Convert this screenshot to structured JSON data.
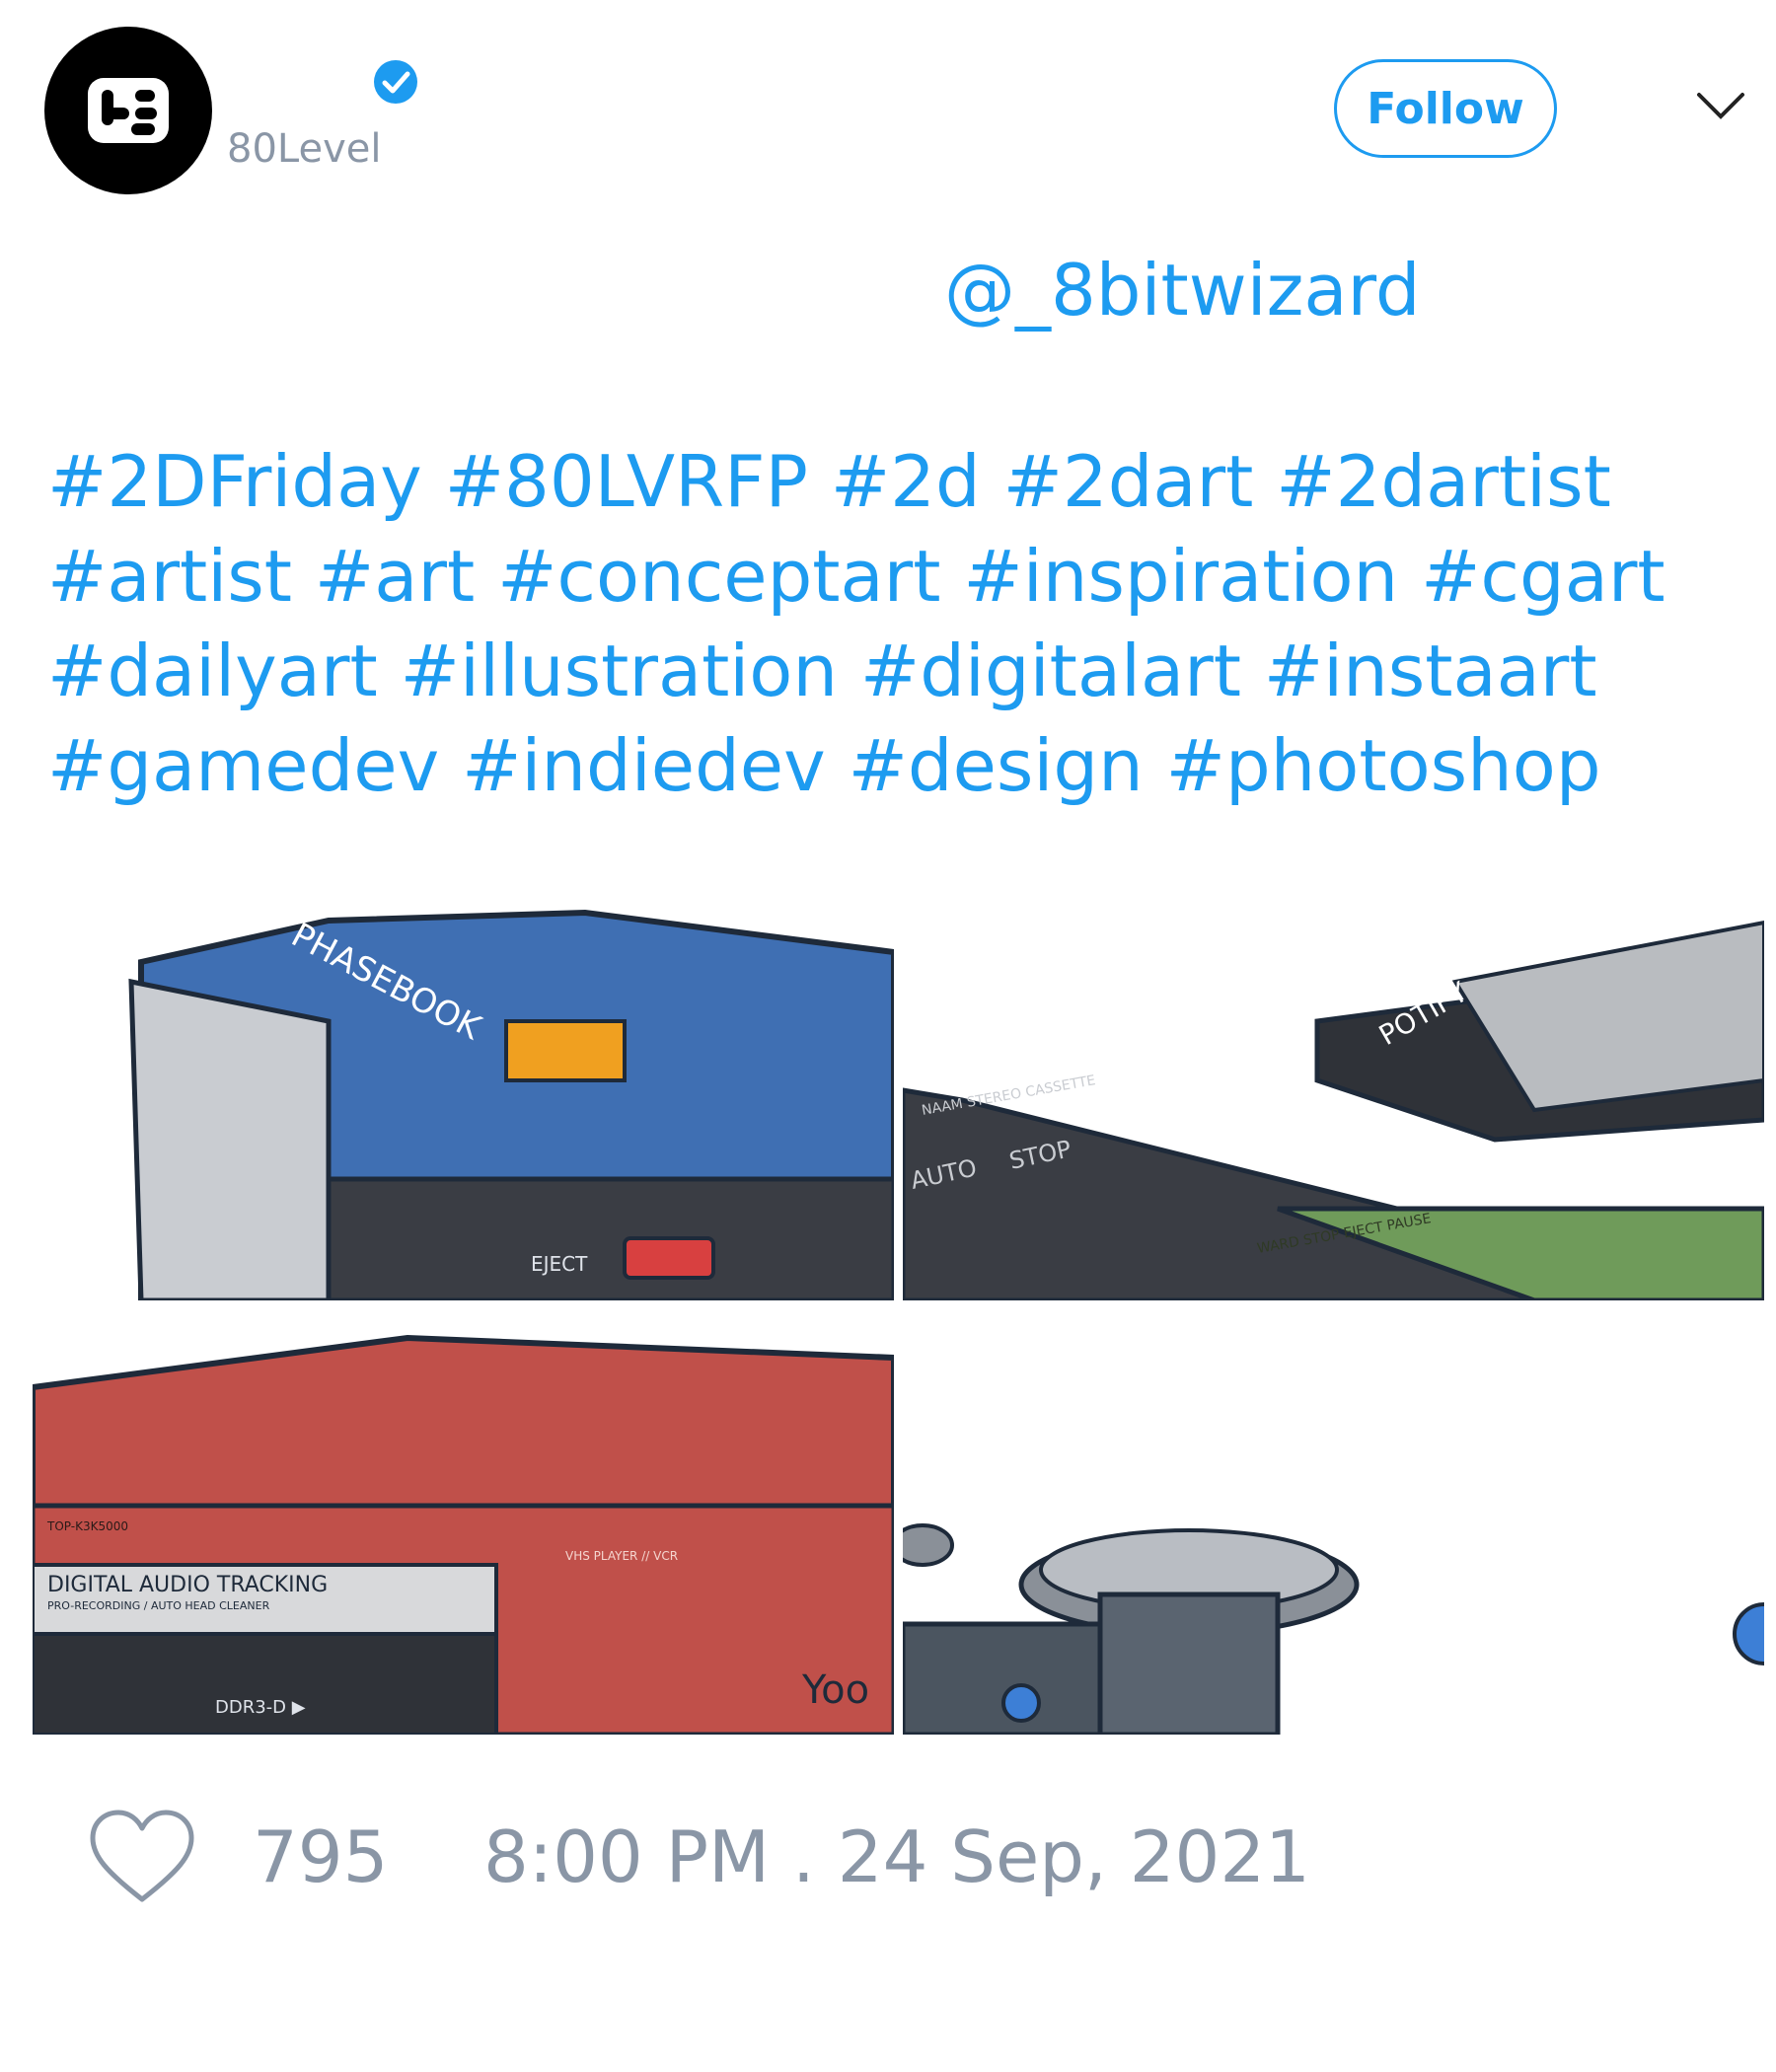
{
  "header": {
    "handle": "80Level",
    "follow_label": "Follow",
    "verified_icon": "verified-badge-icon",
    "menu_icon": "chevron-down-icon"
  },
  "tweet": {
    "mention": "@_8bitwizard",
    "hashtag_lines": [
      [
        "#2DFriday",
        "#80LVRFP",
        "#2d",
        "#2dart",
        "#2dartist"
      ],
      [
        "#artist",
        "#art",
        "#conceptart",
        "#inspiration",
        "#cgart"
      ],
      [
        "#dailyart",
        "#illustration",
        "#digitalart",
        "#instaart"
      ],
      [
        "#gamedev",
        "#indiedev",
        "#design",
        "#photoshop"
      ]
    ],
    "images": {
      "img1": {
        "brand": "PHASEBOOK",
        "eject": "EJECT",
        "accent": "#3f6fb3"
      },
      "img2": {
        "brand": "POTIFY",
        "auto": "AUTO",
        "stop": "STOP",
        "cassette_top": "NAAM STEREO CASSETTE",
        "bottom": "WARD STOP EJECT PAUSE",
        "accent": "#6f9b5a"
      },
      "img3": {
        "model": "TOP-K3K5000",
        "title": "DIGITAL AUDIO TRACKING",
        "subtitle": "PRO-RECORDING / AUTO HEAD CLEANER",
        "vhs": "VHS PLAYER // VCR",
        "ddr": "DDR3-D ▶",
        "logo": "Yoo",
        "accent": "#c0504a"
      },
      "img4": {
        "accent": "#5a6470"
      }
    }
  },
  "footer": {
    "like_icon": "heart-icon",
    "like_count": "795",
    "timestamp": "8:00 PM . 24 Sep, 2021"
  },
  "colors": {
    "link": "#1d9bf0",
    "muted": "#8a96a6"
  }
}
